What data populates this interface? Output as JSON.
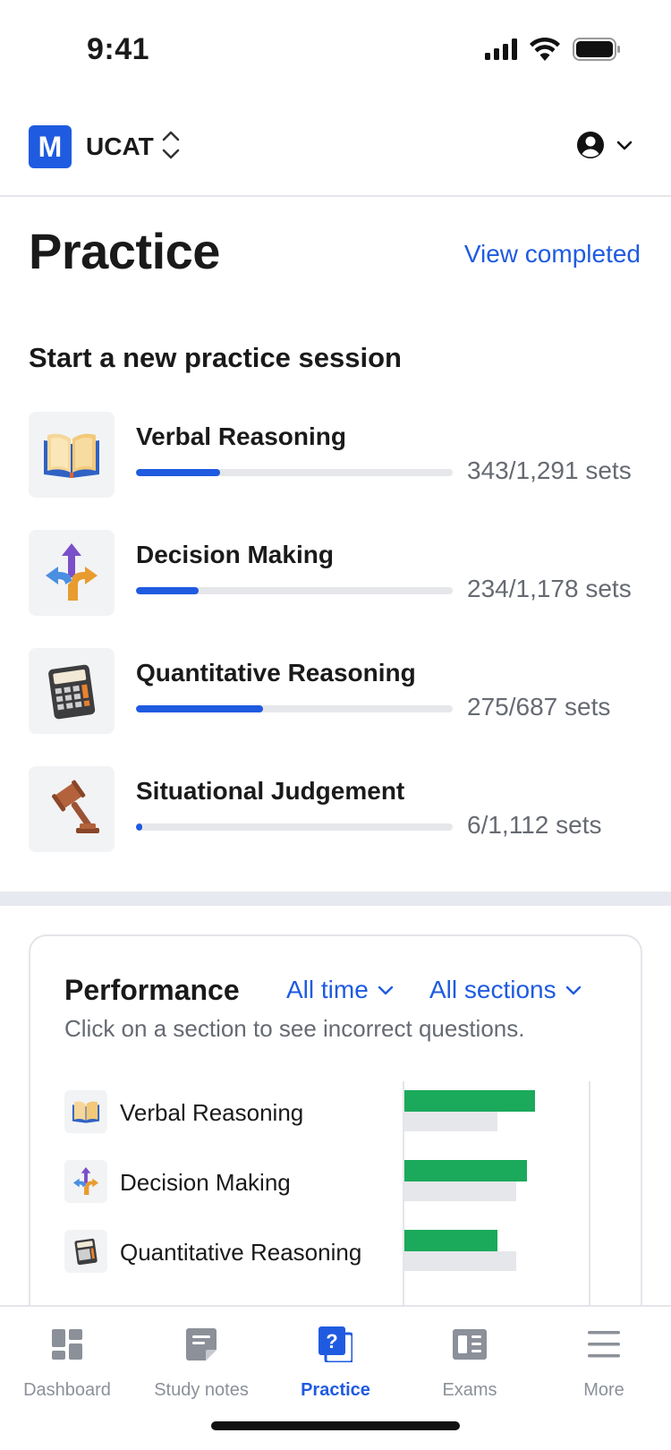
{
  "status_bar": {
    "time": "9:41"
  },
  "header": {
    "logo_letter": "M",
    "course": "UCAT"
  },
  "page": {
    "title": "Practice",
    "view_completed": "View completed"
  },
  "new_session": {
    "heading": "Start a new practice session",
    "sections": [
      {
        "name": "Verbal Reasoning",
        "count": "343/1,291 sets",
        "progress": 0.266,
        "icon": "book-icon"
      },
      {
        "name": "Decision Making",
        "count": "234/1,178 sets",
        "progress": 0.199,
        "icon": "arrows-icon"
      },
      {
        "name": "Quantitative Reasoning",
        "count": "275/687 sets",
        "progress": 0.4,
        "icon": "calculator-icon"
      },
      {
        "name": "Situational Judgement",
        "count": "6/1,112 sets",
        "progress": 0.02,
        "icon": "gavel-icon"
      }
    ]
  },
  "performance": {
    "title": "Performance",
    "filter_time": "All time",
    "filter_sections": "All sections",
    "hint": "Click on a section to see incorrect questions.",
    "rows": [
      {
        "name": "Verbal Reasoning",
        "correct": 0.7,
        "average": 0.5,
        "icon": "book-icon"
      },
      {
        "name": "Decision Making",
        "correct": 0.66,
        "average": 0.6,
        "icon": "arrows-icon"
      },
      {
        "name": "Quantitative Reasoning",
        "correct": 0.5,
        "average": 0.6,
        "icon": "calculator-icon"
      }
    ]
  },
  "tabs": [
    {
      "label": "Dashboard",
      "icon": "dashboard-icon",
      "active": false
    },
    {
      "label": "Study notes",
      "icon": "notes-icon",
      "active": false
    },
    {
      "label": "Practice",
      "icon": "practice-icon",
      "active": true
    },
    {
      "label": "Exams",
      "icon": "exams-icon",
      "active": false
    },
    {
      "label": "More",
      "icon": "menu-icon",
      "active": false
    }
  ],
  "colors": {
    "accent": "#1f5be0",
    "correct": "#1ba95b",
    "track": "#e6e7ea"
  }
}
